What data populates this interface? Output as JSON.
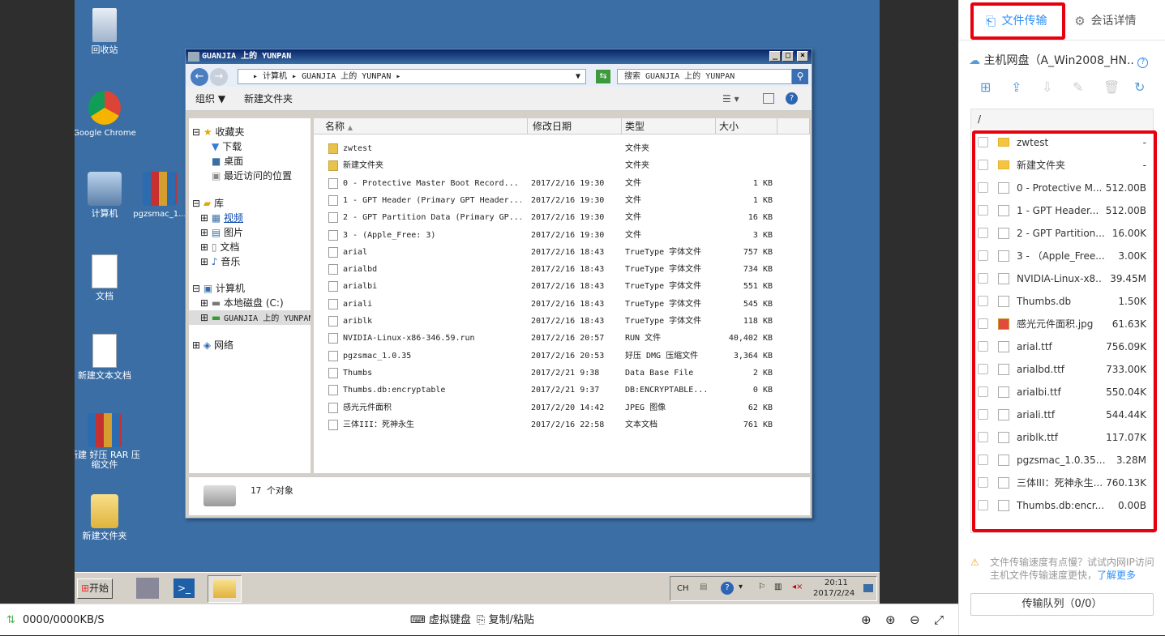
{
  "desktop": {
    "icons": [
      {
        "label": "回收站",
        "name": "recycle-bin"
      },
      {
        "label": "Google Chrome",
        "name": "google-chrome"
      },
      {
        "label": "计算机",
        "name": "computer"
      },
      {
        "label": "pgzsmac_1...",
        "name": "pgzsmac"
      },
      {
        "label": "文档",
        "name": "documents"
      },
      {
        "label": "新建文本文档",
        "name": "new-text-doc"
      },
      {
        "label": "新建 好压 RAR 压缩文件",
        "name": "new-rar"
      },
      {
        "label": "新建文件夹",
        "name": "new-folder"
      }
    ]
  },
  "explorer": {
    "title": "GUANJIA 上的 YUNPAN",
    "address": "▸ 计算机 ▸ GUANJIA 上的 YUNPAN ▸",
    "search_placeholder": "搜索 GUANJIA 上的 YUNPAN",
    "toolbar": {
      "organize": "组织 ▼",
      "new_folder": "新建文件夹"
    },
    "nav": {
      "favorites": "收藏夹",
      "downloads": "下载",
      "desktop": "桌面",
      "recent": "最近访问的位置",
      "libraries": "库",
      "videos": "视频",
      "pictures": "图片",
      "documents": "文档",
      "music": "音乐",
      "computer": "计算机",
      "local_disk": "本地磁盘 (C:)",
      "yunpan": "GUANJIA 上的 YUNPAN",
      "network": "网络"
    },
    "columns": {
      "name": "名称",
      "modified": "修改日期",
      "type": "类型",
      "size": "大小"
    },
    "files": [
      {
        "name": "zwtest",
        "date": "",
        "type": "文件夹",
        "size": "",
        "folder": true
      },
      {
        "name": "新建文件夹",
        "date": "",
        "type": "文件夹",
        "size": "",
        "folder": true
      },
      {
        "name": "0 - Protective Master Boot Record...",
        "date": "2017/2/16 19:30",
        "type": "文件",
        "size": "1 KB"
      },
      {
        "name": "1 - GPT Header (Primary GPT Header...",
        "date": "2017/2/16 19:30",
        "type": "文件",
        "size": "1 KB"
      },
      {
        "name": "2 - GPT Partition Data (Primary GP...",
        "date": "2017/2/16 19:30",
        "type": "文件",
        "size": "16 KB"
      },
      {
        "name": "3 - (Apple_Free: 3)",
        "date": "2017/2/16 19:30",
        "type": "文件",
        "size": "3 KB"
      },
      {
        "name": "arial",
        "date": "2017/2/16 18:43",
        "type": "TrueType 字体文件",
        "size": "757 KB"
      },
      {
        "name": "arialbd",
        "date": "2017/2/16 18:43",
        "type": "TrueType 字体文件",
        "size": "734 KB"
      },
      {
        "name": "arialbi",
        "date": "2017/2/16 18:43",
        "type": "TrueType 字体文件",
        "size": "551 KB"
      },
      {
        "name": "ariali",
        "date": "2017/2/16 18:43",
        "type": "TrueType 字体文件",
        "size": "545 KB"
      },
      {
        "name": "ariblk",
        "date": "2017/2/16 18:43",
        "type": "TrueType 字体文件",
        "size": "118 KB"
      },
      {
        "name": "NVIDIA-Linux-x86-346.59.run",
        "date": "2017/2/16 20:57",
        "type": "RUN 文件",
        "size": "40,402 KB"
      },
      {
        "name": "pgzsmac_1.0.35",
        "date": "2017/2/16 20:53",
        "type": "好压 DMG 压缩文件",
        "size": "3,364 KB"
      },
      {
        "name": "Thumbs",
        "date": "2017/2/21 9:38",
        "type": "Data Base File",
        "size": "2 KB"
      },
      {
        "name": "Thumbs.db:encryptable",
        "date": "2017/2/21 9:37",
        "type": "DB:ENCRYPTABLE...",
        "size": "0 KB"
      },
      {
        "name": "感光元件面积",
        "date": "2017/2/20 14:42",
        "type": "JPEG 图像",
        "size": "62 KB"
      },
      {
        "name": "三体III：死神永生",
        "date": "2017/2/16 22:58",
        "type": "文本文档",
        "size": "761 KB"
      }
    ],
    "status": "17 个对象"
  },
  "taskbar": {
    "start": "开始",
    "lang": "CH",
    "time": "20:11",
    "date": "2017/2/24"
  },
  "bottom": {
    "speed": "0000/0000KB/S",
    "virtual_keyboard": "虚拟键盘",
    "copy_paste": "复制/粘贴"
  },
  "panel": {
    "tab_transfer": "文件传输",
    "tab_session": "会话详情",
    "disk_title": "主机网盘（A_Win2008_HN..",
    "path": "/",
    "files": [
      {
        "name": "zwtest",
        "size": "-",
        "kind": "folder"
      },
      {
        "name": "新建文件夹",
        "size": "-",
        "kind": "folder"
      },
      {
        "name": "0 - Protective M...",
        "size": "512.00B",
        "kind": "file"
      },
      {
        "name": "1 - GPT Header...",
        "size": "512.00B",
        "kind": "file"
      },
      {
        "name": "2 - GPT Partition...",
        "size": "16.00K",
        "kind": "file"
      },
      {
        "name": "3 - （Apple_Free...",
        "size": "3.00K",
        "kind": "file"
      },
      {
        "name": "NVIDIA-Linux-x8..",
        "size": "39.45M",
        "kind": "file"
      },
      {
        "name": "Thumbs.db",
        "size": "1.50K",
        "kind": "file"
      },
      {
        "name": "感光元件面积.jpg",
        "size": "61.63K",
        "kind": "jpg"
      },
      {
        "name": "arial.ttf",
        "size": "756.09K",
        "kind": "file"
      },
      {
        "name": "arialbd.ttf",
        "size": "733.00K",
        "kind": "file"
      },
      {
        "name": "arialbi.ttf",
        "size": "550.04K",
        "kind": "file"
      },
      {
        "name": "ariali.ttf",
        "size": "544.44K",
        "kind": "file"
      },
      {
        "name": "ariblk.ttf",
        "size": "117.07K",
        "kind": "file"
      },
      {
        "name": "pgzsmac_1.0.35....",
        "size": "3.28M",
        "kind": "file"
      },
      {
        "name": "三体III：死神永生...",
        "size": "760.13K",
        "kind": "file"
      },
      {
        "name": "Thumbs.db:encr...",
        "size": "0.00B",
        "kind": "file"
      }
    ],
    "tip": "文件传输速度有点慢？试试内网IP访问主机文件传输速度更快，",
    "tip_link": "了解更多",
    "queue": "传输队列（0/0）"
  }
}
